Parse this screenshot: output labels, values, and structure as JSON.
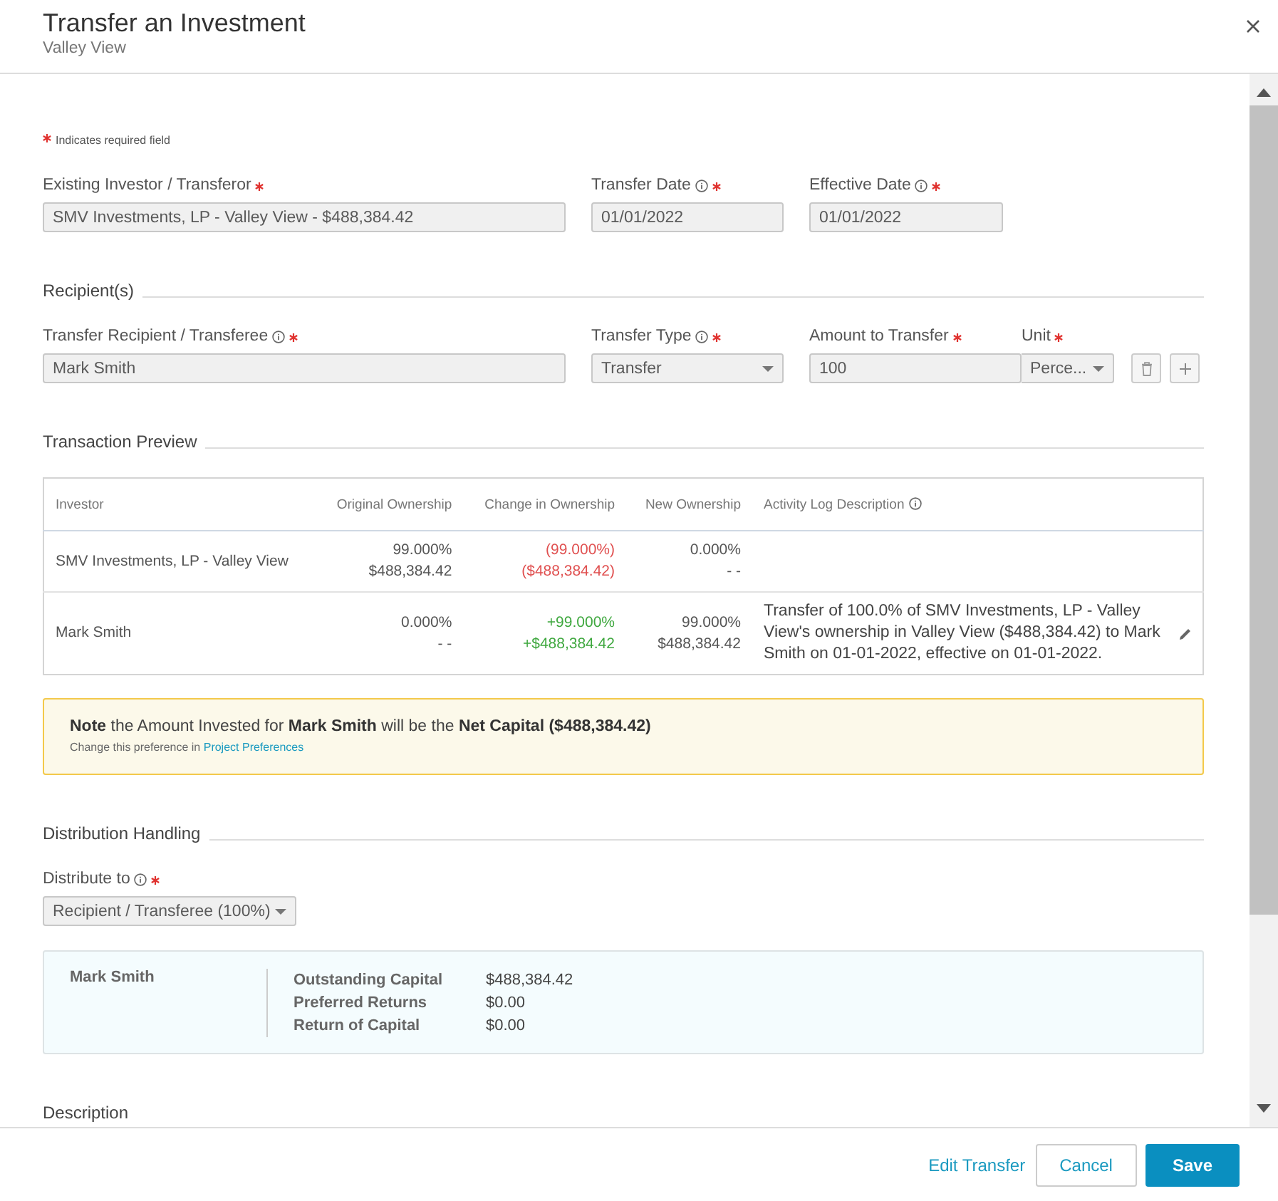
{
  "dialog": {
    "title": "Transfer an Investment",
    "subtitle": "Valley View"
  },
  "required_note": "Indicates required field",
  "transferor_fields": [
    {
      "label": "Existing Investor / Transferor",
      "info": false,
      "required": true,
      "kind": "text",
      "value": "SMV Investments, LP - Valley View - $488,384.42"
    },
    {
      "label": "Transfer Date",
      "info": true,
      "required": true,
      "kind": "text",
      "value": "01/01/2022"
    },
    {
      "label": "Effective Date",
      "info": true,
      "required": true,
      "kind": "text",
      "value": "01/01/2022"
    }
  ],
  "recipients": {
    "title": "Recipient(s)",
    "fields": [
      {
        "label": "Transfer Recipient / Transferee",
        "info": true,
        "required": true,
        "kind": "text",
        "value": "Mark Smith"
      },
      {
        "label": "Transfer Type",
        "info": true,
        "required": true,
        "kind": "select",
        "value": "Transfer"
      },
      {
        "label": "Amount to Transfer",
        "info": false,
        "required": true,
        "kind": "text",
        "value": "100"
      },
      {
        "label": "Unit",
        "info": false,
        "required": true,
        "kind": "unit",
        "value": "Perce..."
      }
    ]
  },
  "transaction_preview": {
    "title": "Transaction Preview",
    "columns": [
      {
        "label": "Investor",
        "info": false
      },
      {
        "label": "Original Ownership",
        "info": false
      },
      {
        "label": "Change in Ownership",
        "info": false
      },
      {
        "label": "New Ownership",
        "info": false
      },
      {
        "label": "Activity Log Description",
        "info": true
      }
    ],
    "rows": [
      {
        "investor": "SMV Investments, LP - Valley View",
        "original": [
          "99.000%",
          "$488,384.42"
        ],
        "change": {
          "percent": "(99.000%)",
          "amount": "($488,384.42)",
          "color": "#e05050"
        },
        "new": [
          "0.000%",
          "- -"
        ],
        "description": "",
        "editable": false
      },
      {
        "investor": "Mark Smith",
        "original": [
          "0.000%",
          "- -"
        ],
        "change": {
          "percent": "+99.000%",
          "amount": "+$488,384.42",
          "color": "#3fa83f"
        },
        "new": [
          "99.000%",
          "$488,384.42"
        ],
        "description": "Transfer of 100.0% of SMV Investments, LP - Valley View's ownership in Valley View ($488,384.42) to Mark Smith on 01-01-2022, effective on 01-01-2022.",
        "editable": true
      }
    ]
  },
  "note": {
    "text": "**Note** the Amount Invested for **Mark Smith** will be the **Net Capital ($488,384.42)**",
    "hint": "Change this preference in",
    "link": "Project Preferences"
  },
  "distribution": {
    "title": "Distribution Handling",
    "field": {
      "label": "Distribute to",
      "info": true,
      "required": true,
      "value": "Recipient / Transferee (100%)"
    },
    "summary": {
      "name": "Mark Smith",
      "items": [
        {
          "label": "Outstanding Capital",
          "value": "$488,384.42"
        },
        {
          "label": "Preferred Returns",
          "value": "$0.00"
        },
        {
          "label": "Return of Capital",
          "value": "$0.00"
        }
      ]
    }
  },
  "description_title": "Description",
  "footer": {
    "link": "Edit Transfer",
    "buttons": [
      {
        "label": "Cancel",
        "kind": "secondary"
      },
      {
        "label": "Save",
        "kind": "primary"
      }
    ]
  }
}
